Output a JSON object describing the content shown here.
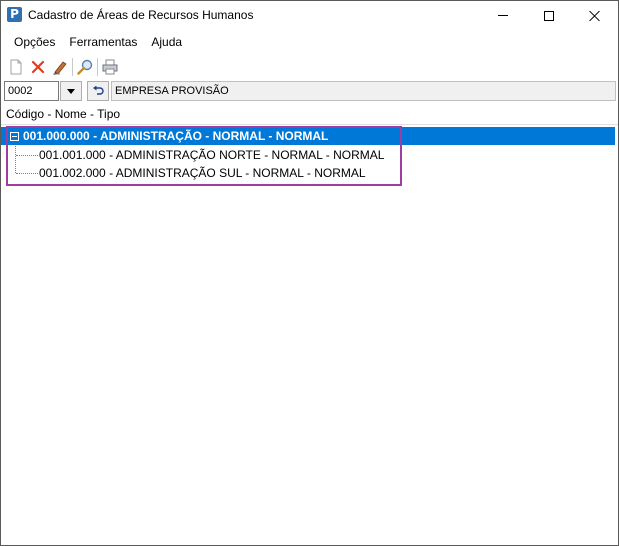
{
  "window": {
    "title": "Cadastro de Áreas de Recursos Humanos",
    "app_icon_letter": "P"
  },
  "menu": {
    "items": [
      "Opções",
      "Ferramentas",
      "Ajuda"
    ]
  },
  "toolbar": {
    "buttons": [
      "new-document-icon",
      "delete-icon",
      "edit-icon",
      "search-icon",
      "print-icon"
    ]
  },
  "company": {
    "code": "0002",
    "name": "EMPRESA PROVISÃO"
  },
  "tree": {
    "column_header": "Código - Nome - Tipo",
    "root": "001.000.000 - ADMINISTRAÇÃO - NORMAL - NORMAL",
    "children": [
      "001.001.000 - ADMINISTRAÇÃO NORTE - NORMAL - NORMAL",
      "001.002.000 - ADMINISTRAÇÃO SUL - NORMAL - NORMAL"
    ]
  },
  "colors": {
    "selection": "#0078d7",
    "highlight_border": "#a03da0",
    "delete_icon": "#e03c1e"
  }
}
